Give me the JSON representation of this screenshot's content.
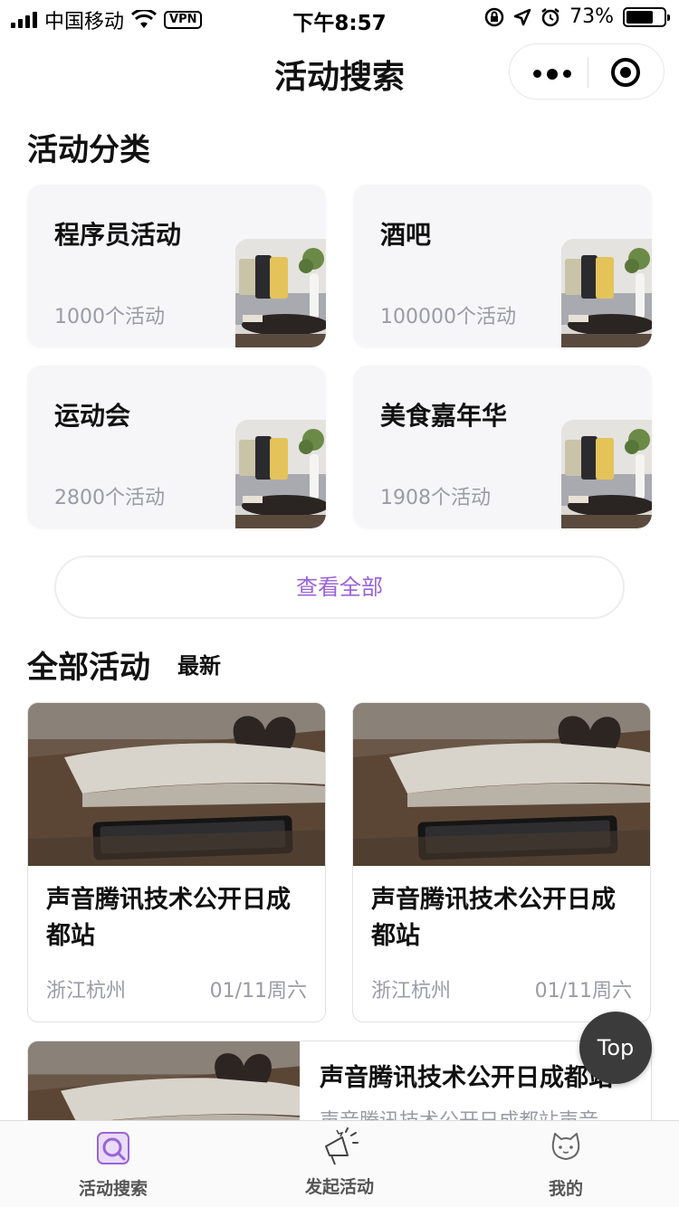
{
  "status_bar": {
    "carrier": "中国移动",
    "vpn": "VPN",
    "time": "下午8:57",
    "battery": "73%",
    "battery_level": 0.73
  },
  "nav": {
    "title": "活动搜索"
  },
  "categories": {
    "title": "活动分类",
    "items": [
      {
        "name": "程序员活动",
        "count": "1000个活动"
      },
      {
        "name": "酒吧",
        "count": "100000个活动"
      },
      {
        "name": "运动会",
        "count": "2800个活动"
      },
      {
        "name": "美食嘉年华",
        "count": "1908个活动"
      }
    ],
    "view_all": "查看全部"
  },
  "activities": {
    "title": "全部活动",
    "sort": "最新",
    "items": [
      {
        "title": "声音腾讯技术公开日成都站",
        "location": "浙江杭州",
        "date": "01/11周六"
      },
      {
        "title": "声音腾讯技术公开日成都站",
        "location": "浙江杭州",
        "date": "01/11周六"
      }
    ],
    "wide_item": {
      "title": "声音腾讯技术公开日成都站",
      "desc": "声音腾讯技术公开日成都站声音"
    }
  },
  "top_button": "Top",
  "tab_bar": {
    "items": [
      {
        "label": "活动搜索",
        "icon": "search-activity-icon",
        "active": true
      },
      {
        "label": "发起活动",
        "icon": "megaphone-icon",
        "active": false
      },
      {
        "label": "我的",
        "icon": "cat-face-icon",
        "active": false
      }
    ]
  },
  "colors": {
    "accent": "#9a63d8",
    "muted_text": "#9a9ba6",
    "card_bg": "#f6f6f8"
  }
}
